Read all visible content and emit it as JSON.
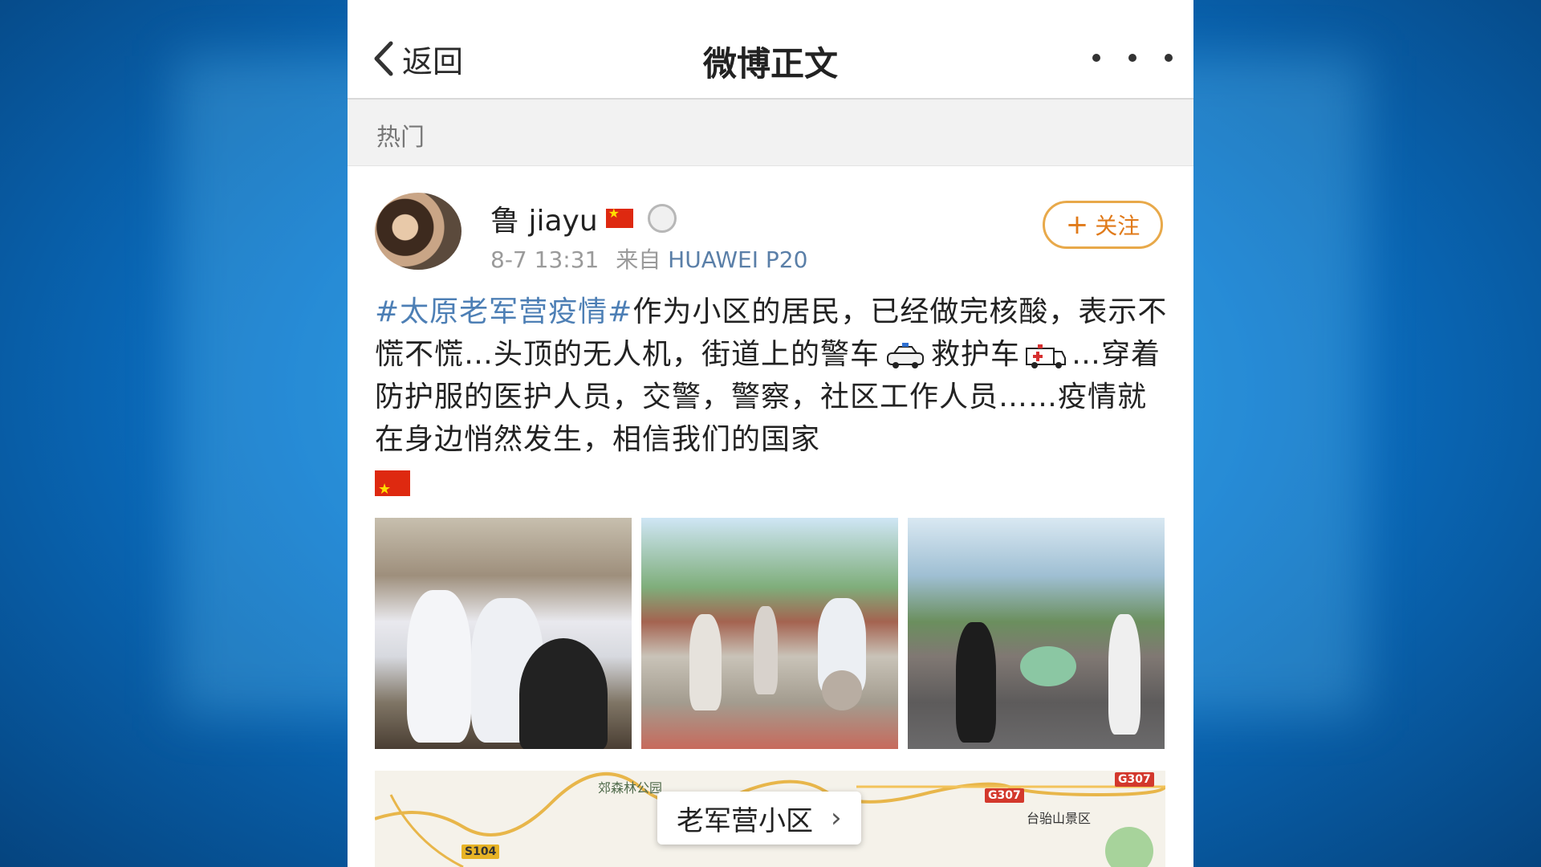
{
  "header": {
    "back_label": "返回",
    "title": "微博正文"
  },
  "section": {
    "label": "热门"
  },
  "post": {
    "username": "鲁 jiayu",
    "time": "8-7 13:31",
    "source_prefix": "来自",
    "device": "HUAWEI P20",
    "follow_label": "关注",
    "hashtag": "#太原老军营疫情#",
    "text_1": "作为小区的居民，已经做完核酸，表示不慌不慌…头顶的无人机，街道上的警车",
    "text_2": "救护车",
    "text_3": "…穿着防护服的医护人员，交警，警察，社区工作人员……疫情就在身边悄然发生，相信我们的国家"
  },
  "map": {
    "location": "老军营小区",
    "park": "郊森林公园",
    "scenic": "台骀山景区",
    "roads": [
      "S104",
      "G307",
      "G307"
    ]
  },
  "icons": {
    "back": "chevron-left-icon",
    "more": "more-dots-icon",
    "flag": "china-flag-icon",
    "medal": "medal-icon",
    "plus": "plus-icon",
    "police_car": "police-car-emoji",
    "ambulance": "ambulance-emoji"
  },
  "colors": {
    "hashtag": "#4d7fb5",
    "follow_border": "#e8a94a",
    "follow_text": "#e07a1a",
    "background": "#0b72c7"
  }
}
